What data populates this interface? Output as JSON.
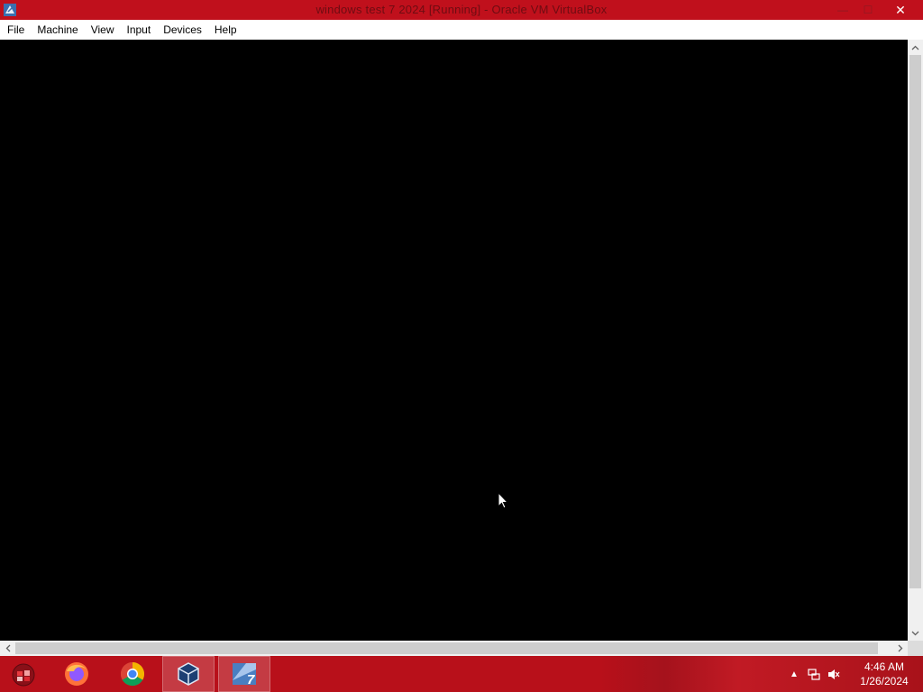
{
  "window": {
    "title": "windows test 7 2024 [Running] - Oracle VM VirtualBox",
    "close_glyph": "✕",
    "minimize_glyph": "—",
    "maximize_glyph": "☐"
  },
  "menubar": {
    "items": [
      "File",
      "Machine",
      "View",
      "Input",
      "Devices",
      "Help"
    ]
  },
  "taskbar": {
    "apps": [
      {
        "name": "start",
        "icon": "start-orb-icon"
      },
      {
        "name": "firefox",
        "icon": "firefox-icon"
      },
      {
        "name": "chrome",
        "icon": "chrome-icon"
      },
      {
        "name": "virtualbox",
        "icon": "virtualbox-icon",
        "active": true
      },
      {
        "name": "windows-7-vm",
        "icon": "windows-7-vm-icon",
        "active": true
      }
    ],
    "tray": {
      "show_hidden_glyph": "▲",
      "time": "4:46 AM",
      "date": "1/26/2024"
    }
  },
  "colors": {
    "titlebar": "#c0101c",
    "taskbar": "#b8101a",
    "vm_background": "#000000"
  }
}
